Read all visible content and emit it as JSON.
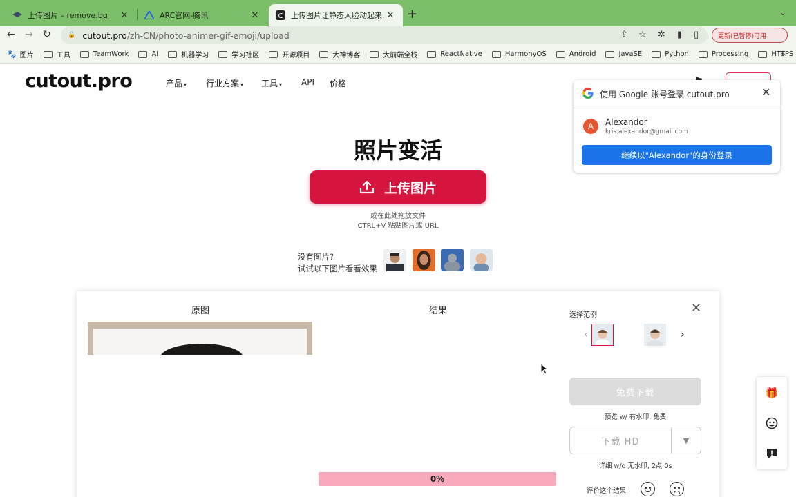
{
  "browser": {
    "tabs": [
      {
        "title": "上传图片 – remove.bg",
        "active": false
      },
      {
        "title": "ARC官网-腾讯",
        "active": false
      },
      {
        "title": "上传图片让静态人脸动起来, 旧照",
        "active": true
      }
    ],
    "url_host": "cutout.pro",
    "url_path": "/zh-CN/photo-animer-gif-emoji/upload",
    "profile_label": "更新(已暂停)可用"
  },
  "bookmarks": [
    "图片",
    "工具",
    "TeamWork",
    "AI",
    "机器学习",
    "学习社区",
    "开源项目",
    "大神博客",
    "大前端全栈",
    "ReactNative",
    "HarmonyOS",
    "Android",
    "JavaSE",
    "Python",
    "Processing",
    "HTTPS"
  ],
  "site": {
    "logo": "cutout.pro",
    "nav": [
      {
        "label": "产品",
        "caret": true
      },
      {
        "label": "行业方案",
        "caret": true
      },
      {
        "label": "工具",
        "caret": true
      },
      {
        "label": "API",
        "caret": false
      },
      {
        "label": "价格",
        "caret": false
      }
    ]
  },
  "hero": {
    "title": "照片变活",
    "upload_label": "上传图片",
    "drop_hint_1": "或在此处拖放文件",
    "drop_hint_2": "CTRL+V 粘贴图片或 URL",
    "try_line_1": "没有图片?",
    "try_line_2": "试试以下图片看看效果"
  },
  "google": {
    "title": "使用 Google 账号登录 cutout.pro",
    "avatar_letter": "A",
    "name": "Alexandor",
    "email": "kris.alexandor@gmail.com",
    "continue_label": "继续以\"Alexandor\"的身份登录"
  },
  "result": {
    "original_label": "原图",
    "result_label": "结果",
    "progress_text": "0%",
    "progress_value": 0,
    "choose_label": "选择范例",
    "free_download": "免费下载",
    "free_note": "预览 w/ 有水印, 免费",
    "hd_download": "下载 HD",
    "hd_note": "详细 w/o 无水印, 2点 0s",
    "rate_label": "评价这个结果"
  },
  "colors": {
    "brand": "#d6153f",
    "tab_strip": "#7bbf6a",
    "google_blue": "#1a73e8"
  },
  "icons": [
    "back-icon",
    "forward-icon",
    "reload-icon",
    "lock-icon",
    "share-icon",
    "star-icon",
    "extension-icon",
    "gift-icon",
    "support-icon",
    "feedback-icon",
    "close-icon"
  ]
}
